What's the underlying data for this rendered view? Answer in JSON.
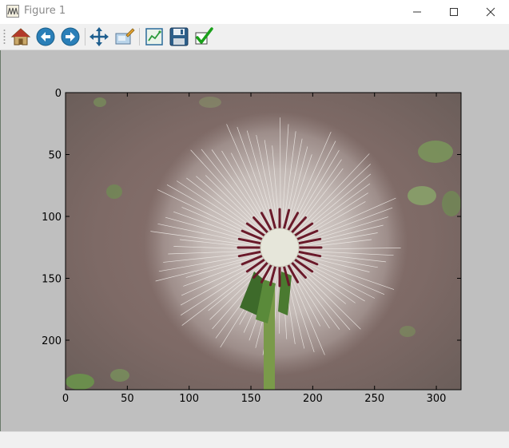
{
  "window": {
    "title": "Figure 1",
    "icon": "matplotlib-figure-icon",
    "controls": [
      "minimize-icon",
      "maximize-icon",
      "close-icon"
    ]
  },
  "toolbar": {
    "buttons": [
      {
        "name": "home",
        "icon": "home-icon"
      },
      {
        "name": "back",
        "icon": "back-arrow-icon"
      },
      {
        "name": "forward",
        "icon": "forward-arrow-icon"
      },
      {
        "name": "pan",
        "icon": "pan-move-icon"
      },
      {
        "name": "zoom",
        "icon": "zoom-rect-icon"
      },
      {
        "name": "configure-subplots",
        "icon": "subplots-icon"
      },
      {
        "name": "save",
        "icon": "floppy-disk-icon"
      },
      {
        "name": "edit-parameters",
        "icon": "checkmark-icon"
      }
    ]
  },
  "plot": {
    "x_ticks": [
      "0",
      "50",
      "100",
      "150",
      "200",
      "250",
      "300"
    ],
    "y_ticks": [
      "0",
      "50",
      "100",
      "150",
      "200"
    ],
    "image_subject": "dandelion seed head photo",
    "colors": {
      "figure_bg": "#bfbfbf",
      "toolbar_bg": "#f0f0f0"
    }
  }
}
